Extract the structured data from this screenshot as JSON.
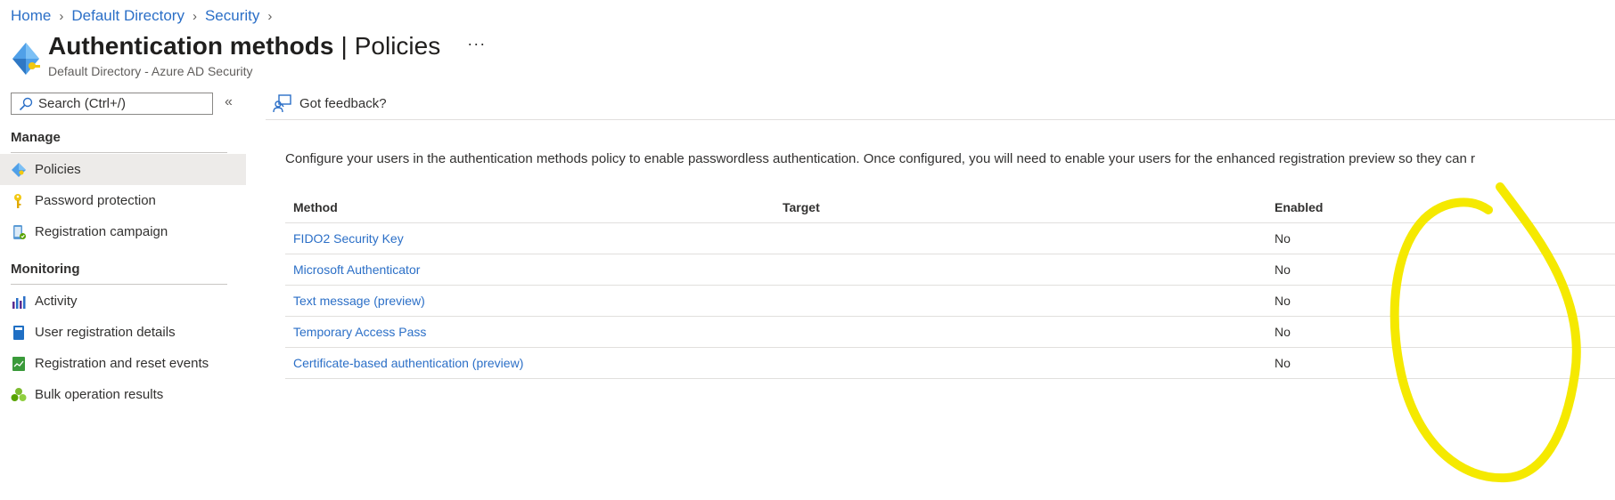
{
  "breadcrumb": [
    {
      "label": "Home"
    },
    {
      "label": "Default Directory"
    },
    {
      "label": "Security"
    }
  ],
  "header": {
    "title": "Authentication methods",
    "separator": "|",
    "section": "Policies",
    "more": "···",
    "subtitle": "Default Directory - Azure AD Security"
  },
  "sidebar": {
    "search_placeholder": "Search (Ctrl+/)",
    "collapse_label": "«",
    "manage_header": "Manage",
    "manage_items": [
      {
        "label": "Policies",
        "icon": "diamond-icon",
        "selected": true
      },
      {
        "label": "Password protection",
        "icon": "key-icon"
      },
      {
        "label": "Registration campaign",
        "icon": "phone-check-icon"
      }
    ],
    "monitoring_header": "Monitoring",
    "monitoring_items": [
      {
        "label": "Activity",
        "icon": "chart-bars-icon"
      },
      {
        "label": "User registration details",
        "icon": "book-icon"
      },
      {
        "label": "Registration and reset events",
        "icon": "log-icon"
      },
      {
        "label": "Bulk operation results",
        "icon": "group-icon"
      }
    ]
  },
  "toolbar": {
    "feedback_label": "Got feedback?"
  },
  "main": {
    "description": "Configure your users in the authentication methods policy to enable passwordless authentication. Once configured, you will need to enable your users for the enhanced registration preview so they can r",
    "columns": {
      "method": "Method",
      "target": "Target",
      "enabled": "Enabled"
    },
    "rows": [
      {
        "method": "FIDO2 Security Key",
        "target": "",
        "enabled": "No"
      },
      {
        "method": "Microsoft Authenticator",
        "target": "",
        "enabled": "No"
      },
      {
        "method": "Text message (preview)",
        "target": "",
        "enabled": "No"
      },
      {
        "method": "Temporary Access Pass",
        "target": "",
        "enabled": "No"
      },
      {
        "method": "Certificate-based authentication (preview)",
        "target": "",
        "enabled": "No"
      }
    ]
  },
  "colors": {
    "link": "#2b6fc7",
    "selected_bg": "#edebe9",
    "annotation": "#f5e900"
  }
}
